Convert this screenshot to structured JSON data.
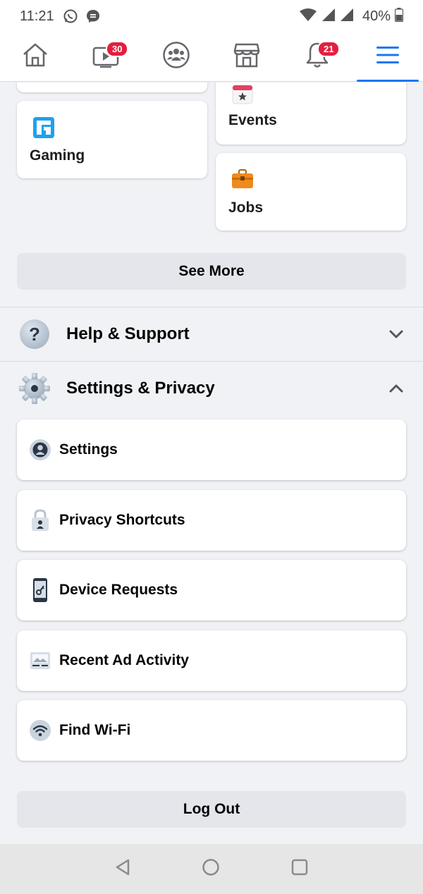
{
  "status_bar": {
    "time": "11:21",
    "battery": "40%"
  },
  "top_nav": {
    "items": [
      {
        "icon": "home-icon"
      },
      {
        "icon": "watch-icon",
        "badge": "30"
      },
      {
        "icon": "groups-icon"
      },
      {
        "icon": "marketplace-icon"
      },
      {
        "icon": "notifications-icon",
        "badge": "21"
      },
      {
        "icon": "menu-icon",
        "active": true
      }
    ],
    "accent": "#1877f2",
    "badge_color": "#e41e3f"
  },
  "shortcuts": {
    "gaming": "Gaming",
    "events": "Events",
    "jobs": "Jobs",
    "see_more": "See More"
  },
  "sections": {
    "help_support": "Help & Support",
    "settings_privacy": "Settings & Privacy"
  },
  "settings_items": [
    {
      "label": "Settings",
      "icon": "account-icon"
    },
    {
      "label": "Privacy Shortcuts",
      "icon": "lock-icon"
    },
    {
      "label": "Device Requests",
      "icon": "phone-key-icon"
    },
    {
      "label": "Recent Ad Activity",
      "icon": "ad-icon"
    },
    {
      "label": "Find Wi-Fi",
      "icon": "wifi-icon"
    }
  ],
  "log_out": "Log Out"
}
